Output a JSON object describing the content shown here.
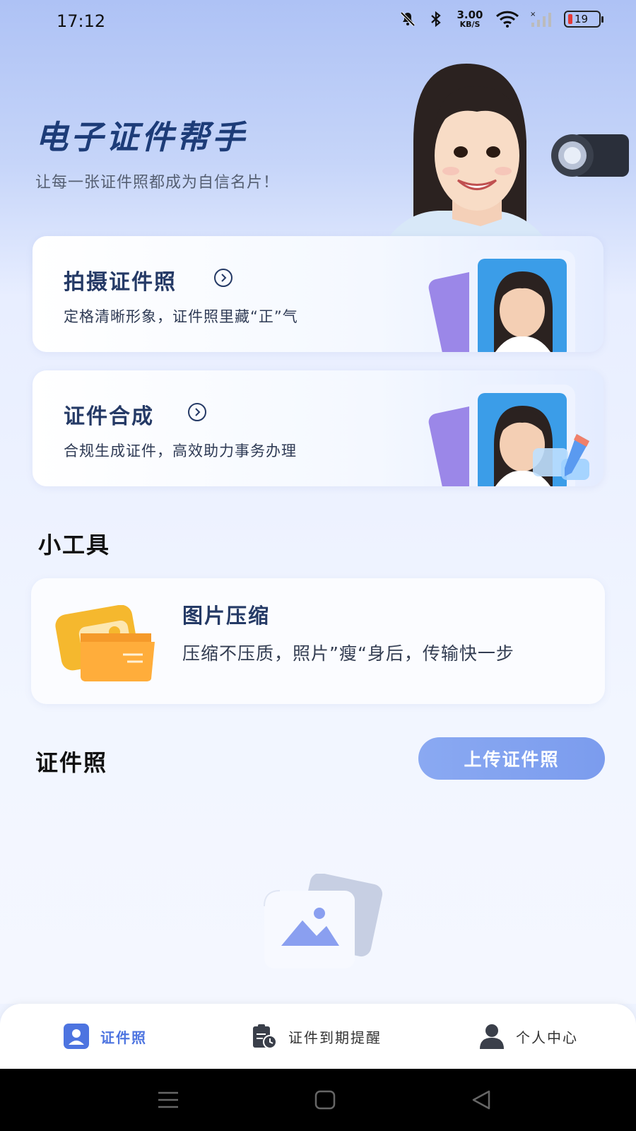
{
  "status_bar": {
    "time": "17:12",
    "net_speed_value": "3.00",
    "net_speed_unit": "KB/S",
    "battery_level": "19",
    "icons": [
      "mute-bell-icon",
      "bluetooth-icon",
      "wifi-icon",
      "cellular-signal-icon",
      "battery-icon"
    ]
  },
  "hero": {
    "title": "电子证件帮手",
    "subtitle": "让每一张证件照都成为自信名片！"
  },
  "features": [
    {
      "title": "拍摄证件照",
      "desc": "定格清晰形象，证件照里藏“正”气"
    },
    {
      "title": "证件合成",
      "desc": "合规生成证件，高效助力事务办理"
    }
  ],
  "tools": {
    "section_title": "小工具",
    "items": [
      {
        "title": "图片压缩",
        "desc": "压缩不压质，照片”瘦“身后，传输快一步"
      }
    ]
  },
  "id_photo": {
    "section_title": "证件照",
    "upload_label": "上传证件照"
  },
  "bottom_nav": {
    "items": [
      {
        "label": "证件照",
        "icon": "id-card-icon",
        "active": true
      },
      {
        "label": "证件到期提醒",
        "icon": "expiry-reminder-icon",
        "active": false
      },
      {
        "label": "个人中心",
        "icon": "user-icon",
        "active": false
      }
    ]
  },
  "colors": {
    "accent": "#4d74e0",
    "button": "#7b9cee",
    "title": "#1d3c78"
  }
}
